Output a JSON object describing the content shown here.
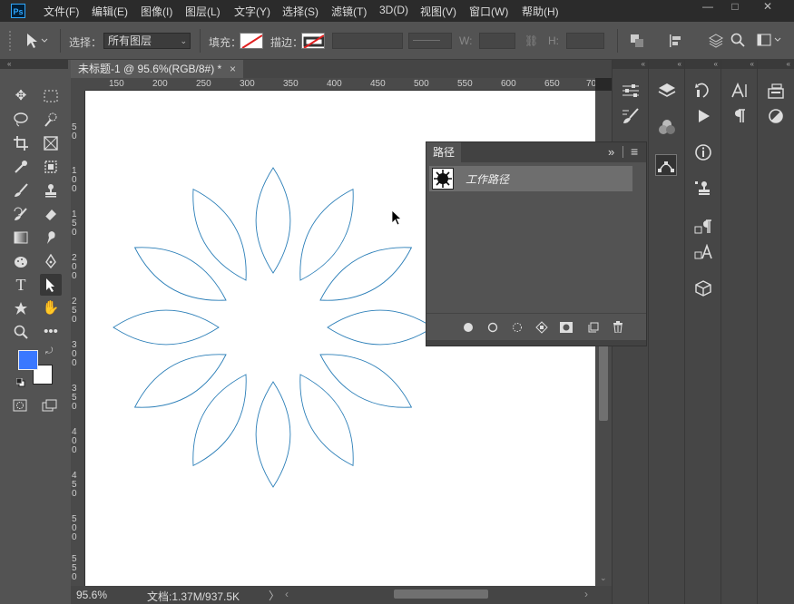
{
  "app": {
    "logo": "Ps"
  },
  "menu": [
    "文件(F)",
    "编辑(E)",
    "图像(I)",
    "图层(L)",
    "文字(Y)",
    "选择(S)",
    "滤镜(T)",
    "3D(D)",
    "视图(V)",
    "窗口(W)",
    "帮助(H)"
  ],
  "window_controls": {
    "minimize": "—",
    "maximize": "□",
    "close": "✕"
  },
  "options": {
    "select_label": "选择：",
    "select_value": "所有图层",
    "fill_label": "填充：",
    "stroke_label": "描边：",
    "w_label": "W:",
    "h_label": "H:"
  },
  "document": {
    "tab_title": "未标题-1 @ 95.6%(RGB/8#) *",
    "tab_close": "×",
    "ruler_h": [
      "150",
      "200",
      "250",
      "300",
      "350",
      "400",
      "450",
      "500",
      "550",
      "600",
      "650",
      "70"
    ],
    "ruler_v": [
      "5\n0",
      "1\n0\n0",
      "1\n5\n0",
      "2\n0\n0",
      "2\n5\n0",
      "3\n0\n0",
      "3\n5\n0",
      "4\n0\n0",
      "4\n5\n0",
      "5\n0\n0",
      "5\n5\n0"
    ],
    "shape": {
      "petals": 12,
      "stroke": "#2c7fb8"
    }
  },
  "status": {
    "zoom": "95.6%",
    "doc_info": "文档:1.37M/937.5K",
    "arrow": "〉"
  },
  "colors": {
    "foreground": "#3a78ff",
    "background": "#ffffff"
  },
  "paths_panel": {
    "tab": "路径",
    "item": "工作路径",
    "menu_icon": "≡",
    "collapse": "»"
  },
  "panel_icons": {
    "col1": [
      "properties-icon",
      "brush-settings-icon"
    ],
    "col2": [
      "layers-icon",
      "channels-icon",
      "paths-icon"
    ],
    "col3": [
      "history-icon",
      "actions-icon",
      "info-icon",
      "clone-source-icon",
      "paragraph-styles-icon",
      "character-styles-icon",
      "3d-icon"
    ],
    "col4": [
      "character-icon",
      "paragraph-icon"
    ],
    "col5": [
      "libraries-icon",
      "adjustments-icon"
    ]
  }
}
